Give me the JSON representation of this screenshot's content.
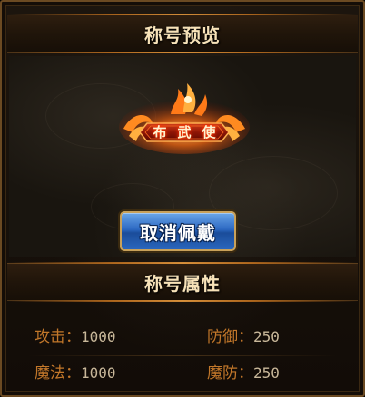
{
  "preview_title": "称号预览",
  "emblem": {
    "name": "布武使"
  },
  "cancel_button": "取消佩戴",
  "attributes_title": "称号属性",
  "attributes": [
    {
      "label": "攻击：",
      "value": "1000"
    },
    {
      "label": "防御：",
      "value": "250"
    },
    {
      "label": "魔法：",
      "value": "1000"
    },
    {
      "label": "魔防：",
      "value": "250"
    }
  ],
  "colors": {
    "accent_gold": "#f0a040",
    "button_blue": "#2c68c2",
    "attr_label": "#c2772a",
    "attr_value": "#c9b89a"
  }
}
